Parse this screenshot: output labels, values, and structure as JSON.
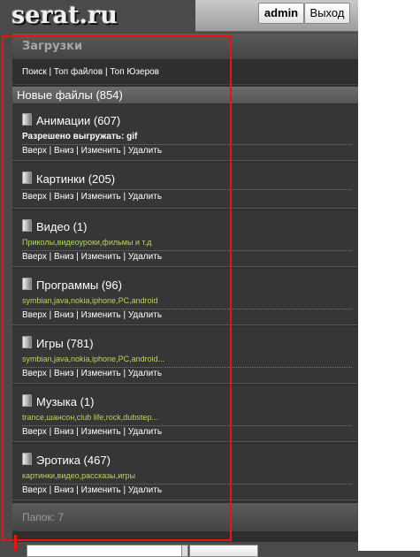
{
  "header": {
    "logo": "serat.ru",
    "admin_label": "admin",
    "exit_label": "Выход"
  },
  "main": {
    "section_title": "Загрузки",
    "links": [
      {
        "label": "Поиск"
      },
      {
        "label": "Топ файлов"
      },
      {
        "label": "Топ Юзеров"
      }
    ],
    "new_files": "Новые файлы (854)",
    "actions": [
      "Вверх",
      "Вниз",
      "Изменить",
      "Удалить"
    ],
    "categories": [
      {
        "title": "Анимации (607)",
        "desc_prefix": "Разрешено выгружать:",
        "desc_value": "gif"
      },
      {
        "title": "Картинки (205)",
        "desc": ""
      },
      {
        "title": "Видео (1)",
        "desc": "Приколы,видеоуроки,фильмы и т.д"
      },
      {
        "title": "Программы (96)",
        "desc": "symbian,java,nokia,iphone,PC,android"
      },
      {
        "title": "Игры (781)",
        "desc": "symbian,java,nokia,iphone,PC,android..."
      },
      {
        "title": "Музыка (1)",
        "desc": "trance,шансон,club life,rock,dubstep..."
      },
      {
        "title": "Эротика (467)",
        "desc": "картинки,видео,рассказы,игры"
      }
    ],
    "footer": "Папок: 7"
  },
  "colors": {
    "desc_accent": "#b8d36a",
    "highlight": "#e11111"
  }
}
